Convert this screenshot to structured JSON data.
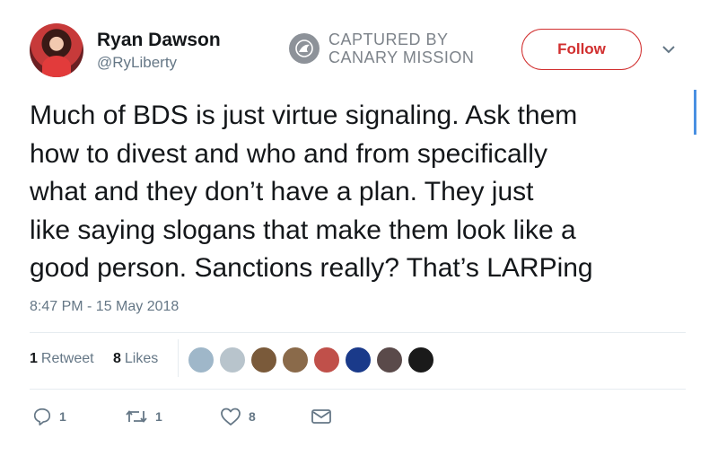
{
  "user": {
    "display_name": "Ryan Dawson",
    "username": "@RyLiberty"
  },
  "stamp": {
    "line1": "CAPTURED BY",
    "line2": "CANARY MISSION",
    "icon": "canary-mission-logo-icon"
  },
  "follow_label": "Follow",
  "tweet": {
    "lines": [
      "Much of BDS is just virtue signaling. Ask them",
      "how to divest and who and from specifically",
      "what and they don’t have a plan. They just",
      "like saying slogans that make them look like a",
      "good person. Sanctions really? That’s LARPing"
    ],
    "timestamp": "8:47 PM - 15 May 2018"
  },
  "stats": {
    "retweets_count": "1",
    "retweets_label": "Retweet",
    "likes_count": "8",
    "likes_label": "Likes"
  },
  "likers": [
    {
      "name": "liker-avatar-1",
      "color": "#9fb7c9"
    },
    {
      "name": "liker-avatar-2",
      "color": "#b8c4cc"
    },
    {
      "name": "liker-avatar-3",
      "color": "#7a5a3a"
    },
    {
      "name": "liker-avatar-4",
      "color": "#8a6a4a"
    },
    {
      "name": "liker-avatar-5",
      "color": "#c0504a"
    },
    {
      "name": "liker-avatar-6",
      "color": "#1a3a8a"
    },
    {
      "name": "liker-avatar-7",
      "color": "#5a4a4a"
    },
    {
      "name": "liker-avatar-8",
      "color": "#1a1a1a"
    }
  ],
  "actions": {
    "reply_count": "1",
    "retweet_count": "1",
    "like_count": "8"
  },
  "colors": {
    "follow_accent": "#d12f2f",
    "muted_text": "#657786",
    "caret": "#4a90e2"
  }
}
